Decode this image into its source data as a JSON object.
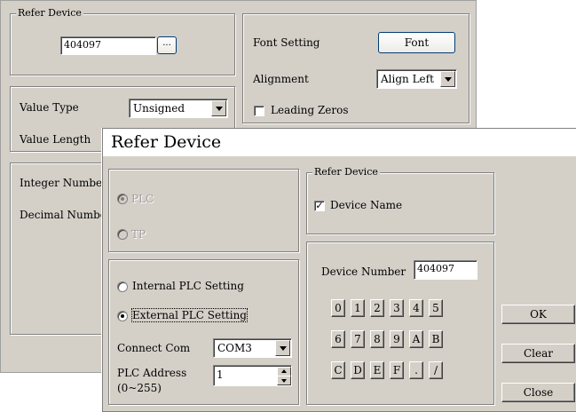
{
  "background": {
    "refer_device": {
      "title": "Refer Device",
      "value": "404097",
      "browse_label": "..."
    },
    "value_type": {
      "label": "Value Type",
      "selected": "Unsigned"
    },
    "value_length": {
      "label": "Value Length"
    },
    "font_setting": {
      "label": "Font Setting",
      "button": "Font"
    },
    "alignment": {
      "label": "Alignment",
      "selected": "Align Left"
    },
    "leading_zeros": {
      "label": "Leading Zeros",
      "checked": false
    },
    "integer_number": {
      "label": "Integer Number"
    },
    "decimal_number": {
      "label": "Decimal Number"
    }
  },
  "dialog": {
    "title": "Refer Device",
    "plc_label": "PLC",
    "tp_label": "TP",
    "refer_group_title": "Refer Device",
    "device_name_label": "Device Name",
    "device_name_checked": true,
    "internal_label": "Internal PLC Setting",
    "external_label": "External PLC Setting",
    "connect_com_label": "Connect Com",
    "connect_com_value": "COM3",
    "plc_address_label": "PLC Address",
    "plc_address_range": "(0~255)",
    "plc_address_value": "1",
    "device_number_label": "Device Number",
    "device_number_value": "404097",
    "keys_row1": [
      "0",
      "1",
      "2",
      "3",
      "4",
      "5"
    ],
    "keys_row2": [
      "6",
      "7",
      "8",
      "9",
      "A",
      "B"
    ],
    "keys_row3": [
      "C",
      "D",
      "E",
      "F",
      ".",
      "/"
    ],
    "ok_label": "OK",
    "clear_label": "Clear",
    "close_label": "Close"
  }
}
